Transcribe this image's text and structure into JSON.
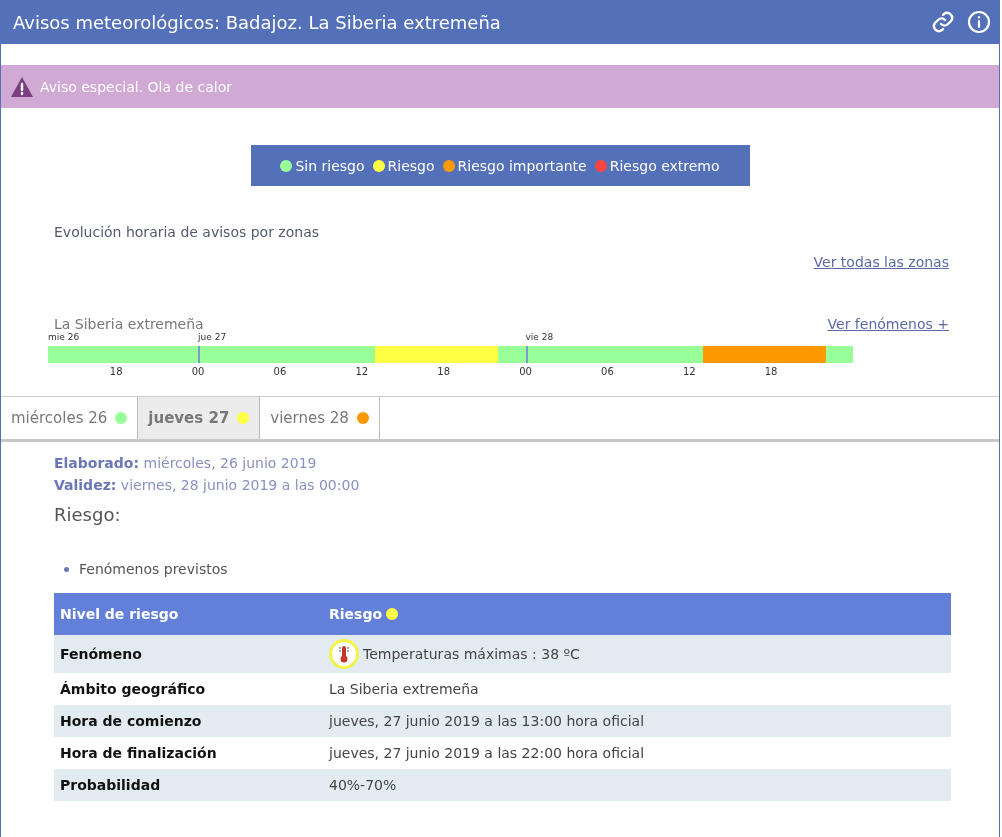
{
  "window": {
    "title": "Avisos meteorológicos: Badajoz. La Siberia extremeña"
  },
  "alert": {
    "text": "Aviso especial. Ola de calor"
  },
  "legend": [
    {
      "label": "Sin riesgo",
      "color": "#99ff99"
    },
    {
      "label": "Riesgo",
      "color": "#ffff44"
    },
    {
      "label": "Riesgo importante",
      "color": "#ff9900"
    },
    {
      "label": "Riesgo extremo",
      "color": "#ff4444"
    }
  ],
  "evolution_title": "Evolución horaria de avisos por zonas",
  "all_zones_link": "Ver todas las zonas",
  "zone": {
    "name": "La Siberia extremeña",
    "link": "Ver fenómenos +",
    "days": [
      "mie 26",
      "jue 27",
      "vie 28"
    ],
    "hours": [
      {
        "color": "#99ff99"
      },
      {
        "color": "#99ff99"
      },
      {
        "color": "#99ff99"
      },
      {
        "color": "#99ff99"
      },
      {
        "color": "#99ff99"
      },
      {
        "color": "#99ff99"
      },
      {
        "color": "#99ff99"
      },
      {
        "color": "#99ff99"
      },
      {
        "color": "#99ff99"
      },
      {
        "color": "#99ff99"
      },
      {
        "color": "#99ff99"
      },
      {
        "color": "#99ff99"
      },
      {
        "color": "#99ff99"
      },
      {
        "color": "#99ff99"
      },
      {
        "color": "#99ff99"
      },
      {
        "color": "#99ff99"
      },
      {
        "color": "#99ff99"
      },
      {
        "color": "#99ff99"
      },
      {
        "color": "#99ff99"
      },
      {
        "color": "#99ff99"
      },
      {
        "color": "#99ff99"
      },
      {
        "color": "#99ff99"
      },
      {
        "color": "#99ff99"
      },
      {
        "color": "#99ff99"
      },
      {
        "color": "#ffff44"
      },
      {
        "color": "#ffff44"
      },
      {
        "color": "#ffff44"
      },
      {
        "color": "#ffff44"
      },
      {
        "color": "#ffff44"
      },
      {
        "color": "#ffff44"
      },
      {
        "color": "#ffff44"
      },
      {
        "color": "#ffff44"
      },
      {
        "color": "#ffff44"
      },
      {
        "color": "#99ff99"
      },
      {
        "color": "#99ff99"
      },
      {
        "color": "#99ff99"
      },
      {
        "color": "#99ff99"
      },
      {
        "color": "#99ff99"
      },
      {
        "color": "#99ff99"
      },
      {
        "color": "#99ff99"
      },
      {
        "color": "#99ff99"
      },
      {
        "color": "#99ff99"
      },
      {
        "color": "#99ff99"
      },
      {
        "color": "#99ff99"
      },
      {
        "color": "#99ff99"
      },
      {
        "color": "#99ff99"
      },
      {
        "color": "#99ff99"
      },
      {
        "color": "#99ff99"
      },
      {
        "color": "#ff9900"
      },
      {
        "color": "#ff9900"
      },
      {
        "color": "#ff9900"
      },
      {
        "color": "#ff9900"
      },
      {
        "color": "#ff9900"
      },
      {
        "color": "#ff9900"
      },
      {
        "color": "#ff9900"
      },
      {
        "color": "#ff9900"
      },
      {
        "color": "#ff9900"
      },
      {
        "color": "#99ff99"
      },
      {
        "color": "#99ff99"
      }
    ],
    "ticks": [
      "18",
      "00",
      "06",
      "12",
      "18",
      "00",
      "06",
      "12",
      "18"
    ]
  },
  "tabs": [
    {
      "label": "miércoles 26",
      "color": "#99ff99",
      "selected": false
    },
    {
      "label": "jueves 27",
      "color": "#ffff44",
      "selected": true
    },
    {
      "label": "viernes 28",
      "color": "#ff9900",
      "selected": false
    }
  ],
  "elaborado": {
    "label": "Elaborado:",
    "value": "miércoles, 26 junio 2019"
  },
  "validez": {
    "label": "Validez:",
    "value": "viernes, 28 junio 2019 a las 00:00"
  },
  "risk_heading": "Riesgo:",
  "bullet": "Fenómenos previstos",
  "table": {
    "header": {
      "label": "Nivel de riesgo",
      "value": "Riesgo",
      "color": "#ffff44"
    },
    "rows": [
      {
        "label": "Fenómeno",
        "value": "Temperaturas máximas : 38 ºC",
        "kind": "phenomenon"
      },
      {
        "label": "Ámbito geográfico",
        "value": "La Siberia extremeña",
        "kind": "text"
      },
      {
        "label": "Hora de comienzo",
        "value": "jueves, 27 junio 2019 a las 13:00 hora oficial",
        "kind": "text"
      },
      {
        "label": "Hora de finalización",
        "value": "jueves, 27 junio 2019 a las 22:00 hora oficial",
        "kind": "text"
      },
      {
        "label": "Probabilidad",
        "value": "40%-70%",
        "kind": "text"
      }
    ]
  }
}
